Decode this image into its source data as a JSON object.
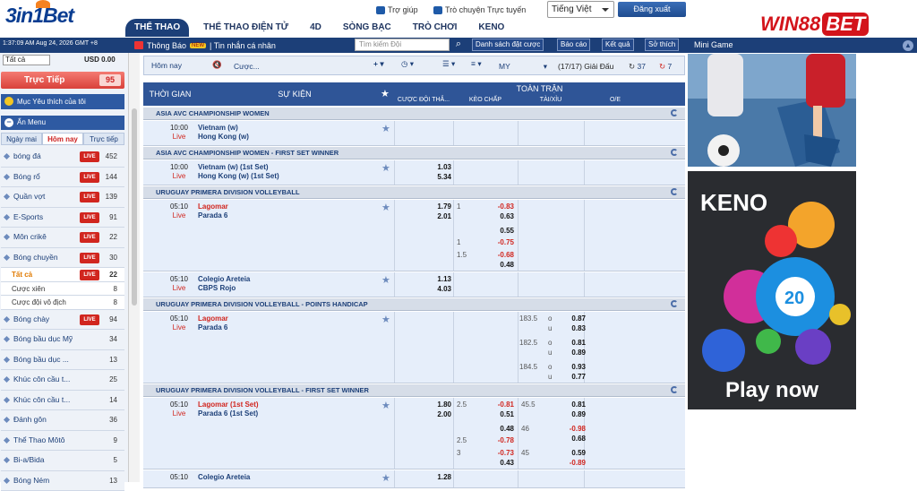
{
  "header": {
    "logo_text": "3in1Bet",
    "help": "Trợ giúp",
    "chat": "Trò chuyện Trực tuyến",
    "language": "Tiếng Việt",
    "logout": "Đăng xuất",
    "brand_text": "WIN88",
    "brand_suffix": "BET"
  },
  "nav": [
    "THỂ THAO",
    "THỂ THAO ĐIỆN TỬ",
    "4D",
    "SÒNG BẠC",
    "TRÒ CHƠI",
    "KENO"
  ],
  "subbar": {
    "clock": "1:37:09 AM Aug 24, 2026 GMT +8",
    "notice": "Thông Báo",
    "new_badge": "NEW",
    "messages": "| Tin nhắn cá nhân",
    "search_placeholder": "Tìm kiếm Đội",
    "buttons": [
      "Danh sách đặt cược",
      "Báo cáo",
      "Kết quả",
      "Sở thích"
    ],
    "minigame": "Mini Game"
  },
  "sidebar": {
    "select": "Tất cả",
    "balance": "USD 0.00",
    "live_label": "Trực Tiếp",
    "live_count": "95",
    "favorites": "Mục Yêu thích của tôi",
    "hide_menu": "Ẩn Menu",
    "tabs": [
      "Ngày mai",
      "Hôm nay",
      "Trực tiếp"
    ],
    "sports": [
      {
        "name": "bóng đá",
        "live": true,
        "count": "452"
      },
      {
        "name": "Bóng rổ",
        "live": true,
        "count": "144"
      },
      {
        "name": "Quần vợt",
        "live": true,
        "count": "139"
      },
      {
        "name": "E-Sports",
        "live": true,
        "count": "91"
      },
      {
        "name": "Môn crikê",
        "live": true,
        "count": "22"
      },
      {
        "name": "Bóng chuyền",
        "live": true,
        "count": "30"
      }
    ],
    "sub_items": [
      {
        "name": "Tất cả",
        "live": true,
        "count": "22"
      },
      {
        "name": "Cược xiên",
        "live": false,
        "count": "8"
      },
      {
        "name": "Cược đội vô địch",
        "live": false,
        "count": "8"
      }
    ],
    "sports2": [
      {
        "name": "Bóng chày",
        "live": true,
        "count": "94"
      },
      {
        "name": "Bóng bầu dục Mỹ",
        "live": false,
        "count": "34"
      },
      {
        "name": "Bóng bầu dục ...",
        "live": false,
        "count": "13"
      },
      {
        "name": "Khúc côn cầu t...",
        "live": false,
        "count": "25"
      },
      {
        "name": "Khúc côn cầu t...",
        "live": false,
        "count": "14"
      },
      {
        "name": "Đánh gôn",
        "live": false,
        "count": "36"
      },
      {
        "name": "Thể Thao Môtô",
        "live": false,
        "count": "9"
      },
      {
        "name": "Bi-a/Bida",
        "live": false,
        "count": "5"
      },
      {
        "name": "Bóng Ném",
        "live": false,
        "count": "13"
      }
    ],
    "live_badge": "LIVE"
  },
  "toolbar": {
    "today": "Hôm nay",
    "bet_placeholder": "Cược...",
    "odds_type": "MY",
    "count": "(17/17) Giải Đấu",
    "refresh1": "37",
    "refresh2": "7"
  },
  "table_header": {
    "time": "THỜI GIAN",
    "event": "SỰ KIỆN",
    "full": "TOÀN TRẬN",
    "c1": "CƯỢC ĐỘI THẮ...",
    "c2": "KÈO CHẤP",
    "c3": "TÀI/XỈU",
    "c4": "O/E"
  },
  "leagues": [
    "ASIA AVC CHAMPIONSHIP WOMEN",
    "ASIA AVC CHAMPIONSHIP WOMEN - FIRST SET WINNER",
    "URUGUAY PRIMERA DIVISION VOLLEYBALL",
    "URUGUAY PRIMERA DIVISION VOLLEYBALL - POINTS HANDICAP",
    "URUGUAY PRIMERA DIVISION VOLLEYBALL - FIRST SET WINNER"
  ],
  "matches": {
    "m1": {
      "time": "10:00",
      "live": "Live",
      "home": "Vietnam (w)",
      "away": "Hong Kong (w)"
    },
    "m2": {
      "time": "10:00",
      "live": "Live",
      "home": "Vietnam (w) (1st Set)",
      "away": "Hong Kong (w) (1st Set)",
      "o1": "1.03",
      "o2": "5.34"
    },
    "m3": {
      "time": "05:10",
      "live": "Live",
      "home": "Lagomar",
      "away": "Parada 6",
      "o1": "1.79",
      "o2": "2.01",
      "hc": [
        [
          "1",
          "-0.83",
          "0.63"
        ],
        [
          "",
          "0.55",
          ""
        ],
        [
          "1",
          "-0.75",
          ""
        ],
        [
          "1.5",
          "-0.68",
          "0.48"
        ]
      ]
    },
    "m4": {
      "time": "05:10",
      "live": "Live",
      "home": "Colegio Areteia",
      "away": "CBPS Rojo",
      "o1": "1.13",
      "o2": "4.03"
    },
    "m5": {
      "time": "05:10",
      "live": "Live",
      "home": "Lagomar",
      "away": "Parada 6",
      "ou": [
        [
          "183.5",
          "o",
          "0.87",
          "u",
          "0.83"
        ],
        [
          "182.5",
          "o",
          "0.81",
          "u",
          "0.89"
        ],
        [
          "184.5",
          "o",
          "0.93",
          "u",
          "0.77"
        ]
      ]
    },
    "m6": {
      "time": "05:10",
      "live": "Live",
      "home": "Lagomar (1st Set)",
      "away": "Parada 6 (1st Set)",
      "o1": "1.80",
      "o2": "2.00",
      "hc": [
        [
          "2.5",
          "-0.81",
          "0.51"
        ],
        [
          "",
          "0.48",
          ""
        ],
        [
          "2.5",
          "-0.78",
          ""
        ],
        [
          "3",
          "-0.73",
          "0.43"
        ]
      ],
      "ou": [
        [
          "45.5",
          "0.81",
          "0.89"
        ],
        [
          "46",
          "-0.98",
          "0.68"
        ],
        [
          "45",
          "0.59",
          "-0.89"
        ]
      ]
    },
    "m7": {
      "time": "05:10",
      "home": "Colegio Areteia",
      "o1": "1.28"
    }
  },
  "ads": {
    "keno": "KENO",
    "play": "Play now",
    "ball": "20"
  }
}
